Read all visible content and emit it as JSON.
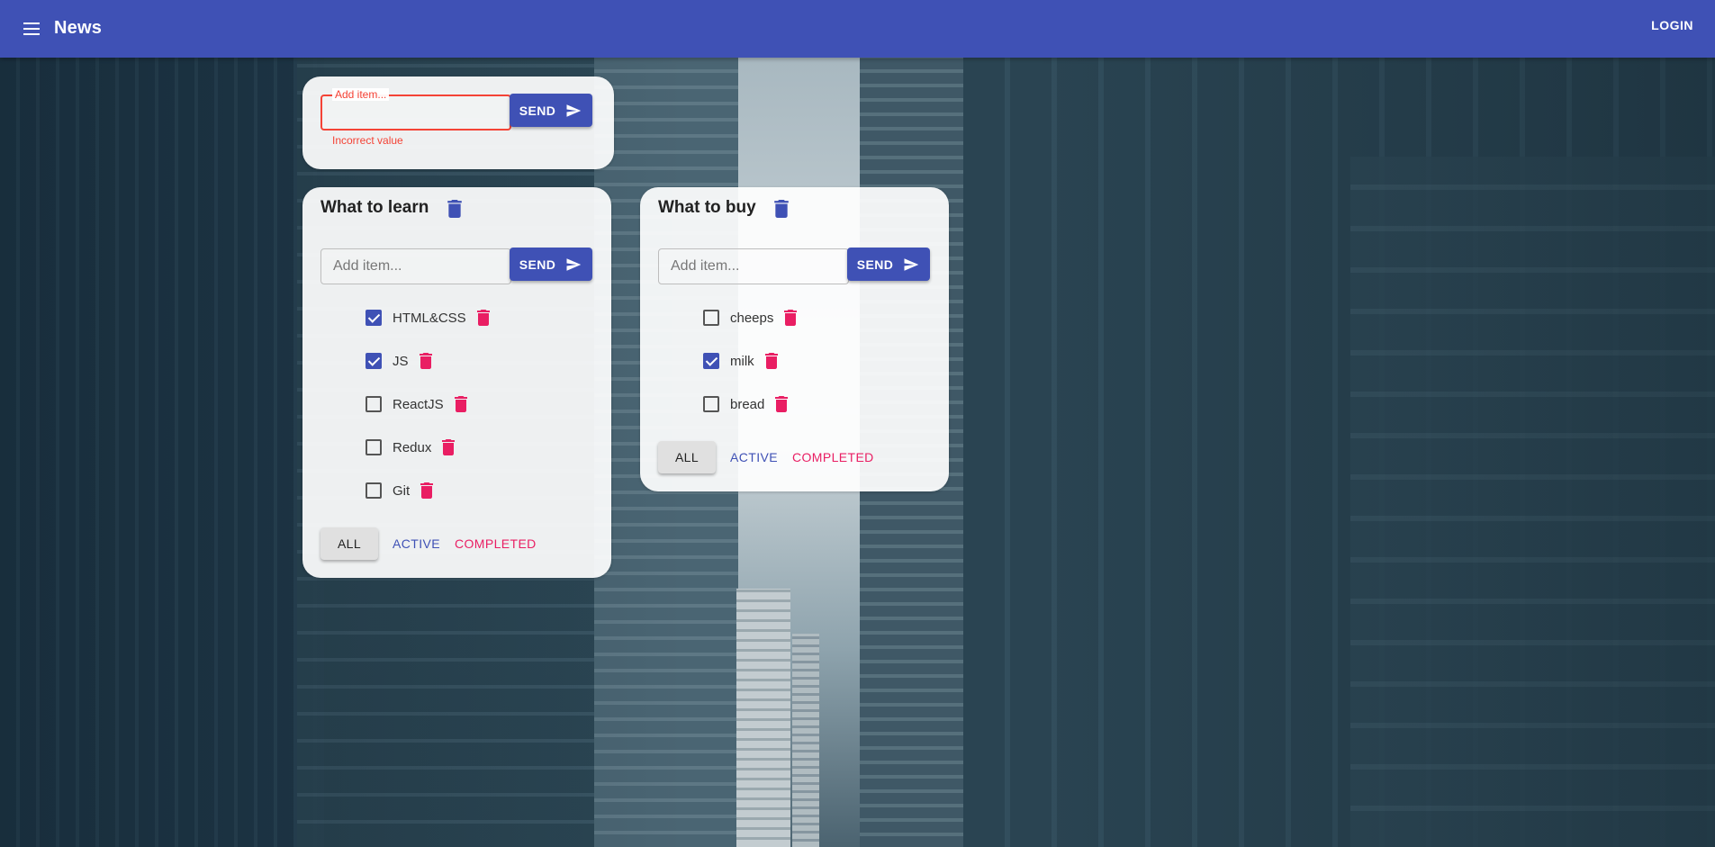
{
  "appbar": {
    "title": "News",
    "login_label": "LOGIN",
    "color": "#3f51b5"
  },
  "add_list": {
    "input_label": "Add item...",
    "input_value": "",
    "error_text": "Incorrect value",
    "send_label": "SEND"
  },
  "lists": [
    {
      "title": "What to learn",
      "input_placeholder": "Add item...",
      "send_label": "SEND",
      "tasks": [
        {
          "label": "HTML&CSS",
          "done": true
        },
        {
          "label": "JS",
          "done": true
        },
        {
          "label": "ReactJS",
          "done": false
        },
        {
          "label": "Redux",
          "done": false
        },
        {
          "label": "Git",
          "done": false
        }
      ],
      "filters": {
        "all": "ALL",
        "active": "ACTIVE",
        "completed": "COMPLETED",
        "selected": "ALL"
      }
    },
    {
      "title": "What to buy",
      "input_placeholder": "Add item...",
      "send_label": "SEND",
      "tasks": [
        {
          "label": "cheeps",
          "done": false
        },
        {
          "label": "milk",
          "done": true
        },
        {
          "label": "bread",
          "done": false
        }
      ],
      "filters": {
        "all": "ALL",
        "active": "ACTIVE",
        "completed": "COMPLETED",
        "selected": "ALL"
      }
    }
  ],
  "icons": {
    "menu": "menu-icon",
    "send": "send-icon",
    "delete": "trash-icon"
  },
  "colors": {
    "primary": "#3f51b5",
    "secondary": "#e91e63",
    "error": "#f44336"
  }
}
